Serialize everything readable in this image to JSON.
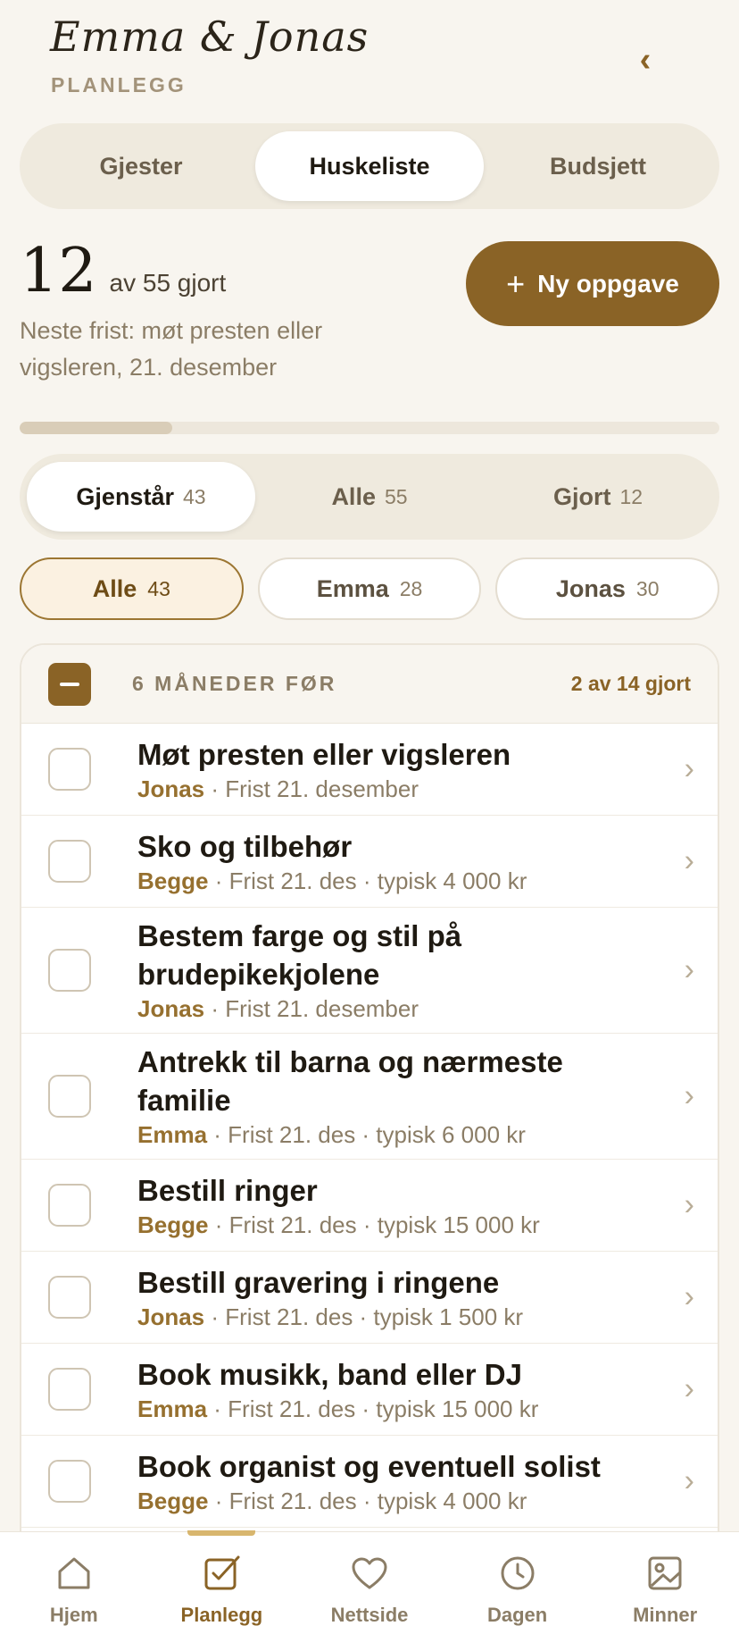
{
  "header": {
    "couple_name": "Emma & Jonas",
    "section": "PLANLEGG"
  },
  "main_tabs": [
    {
      "label": "Gjester",
      "active": false
    },
    {
      "label": "Huskeliste",
      "active": true
    },
    {
      "label": "Budsjett",
      "active": false
    }
  ],
  "summary": {
    "done_count": "12",
    "of_total": "av 55 gjort",
    "next_deadline": "Neste frist: møt presten eller vigsleren, 21. desember",
    "progress_fraction": 0.218
  },
  "new_task_label": "Ny oppgave",
  "status_tabs": [
    {
      "label": "Gjenstår",
      "count": "43",
      "active": true
    },
    {
      "label": "Alle",
      "count": "55",
      "active": false
    },
    {
      "label": "Gjort",
      "count": "12",
      "active": false
    }
  ],
  "person_filters": [
    {
      "label": "Alle",
      "count": "43",
      "active": true
    },
    {
      "label": "Emma",
      "count": "28",
      "active": false
    },
    {
      "label": "Jonas",
      "count": "30",
      "active": false
    }
  ],
  "group": {
    "title": "6 MÅNEDER FØR",
    "progress": "2 av 14 gjort"
  },
  "tasks": [
    {
      "title": "Møt presten eller vigsleren",
      "who": "Jonas",
      "meta": " · Frist 21. desember"
    },
    {
      "title": "Sko og tilbehør",
      "who": "Begge",
      "meta": " · Frist 21. des · typisk 4 000 kr"
    },
    {
      "title": "Bestem farge og stil på brudepikekjolene",
      "who": "Jonas",
      "meta": " · Frist 21. desember"
    },
    {
      "title": "Antrekk til barna og nærmeste familie",
      "who": "Emma",
      "meta": " · Frist 21. des · typisk 6 000 kr"
    },
    {
      "title": "Bestill ringer",
      "who": "Begge",
      "meta": " · Frist 21. des · typisk 15 000 kr"
    },
    {
      "title": "Bestill gravering i ringene",
      "who": "Jonas",
      "meta": " · Frist 21. des · typisk 1 500 kr"
    },
    {
      "title": "Book musikk, band eller DJ",
      "who": "Emma",
      "meta": " · Frist 21. des · typisk 15 000 kr"
    },
    {
      "title": "Book organist og eventuell solist",
      "who": "Begge",
      "meta": " · Frist 21. des · typisk 4 000 kr"
    }
  ],
  "bottom_nav": [
    {
      "label": "Hjem",
      "icon": "home-icon",
      "active": false
    },
    {
      "label": "Planlegg",
      "icon": "checklist-icon",
      "active": true
    },
    {
      "label": "Nettside",
      "icon": "heart-icon",
      "active": false
    },
    {
      "label": "Dagen",
      "icon": "clock-icon",
      "active": false
    },
    {
      "label": "Minner",
      "icon": "image-icon",
      "active": false
    }
  ],
  "colors": {
    "accent": "#8a6326",
    "background": "#f8f5ef"
  }
}
